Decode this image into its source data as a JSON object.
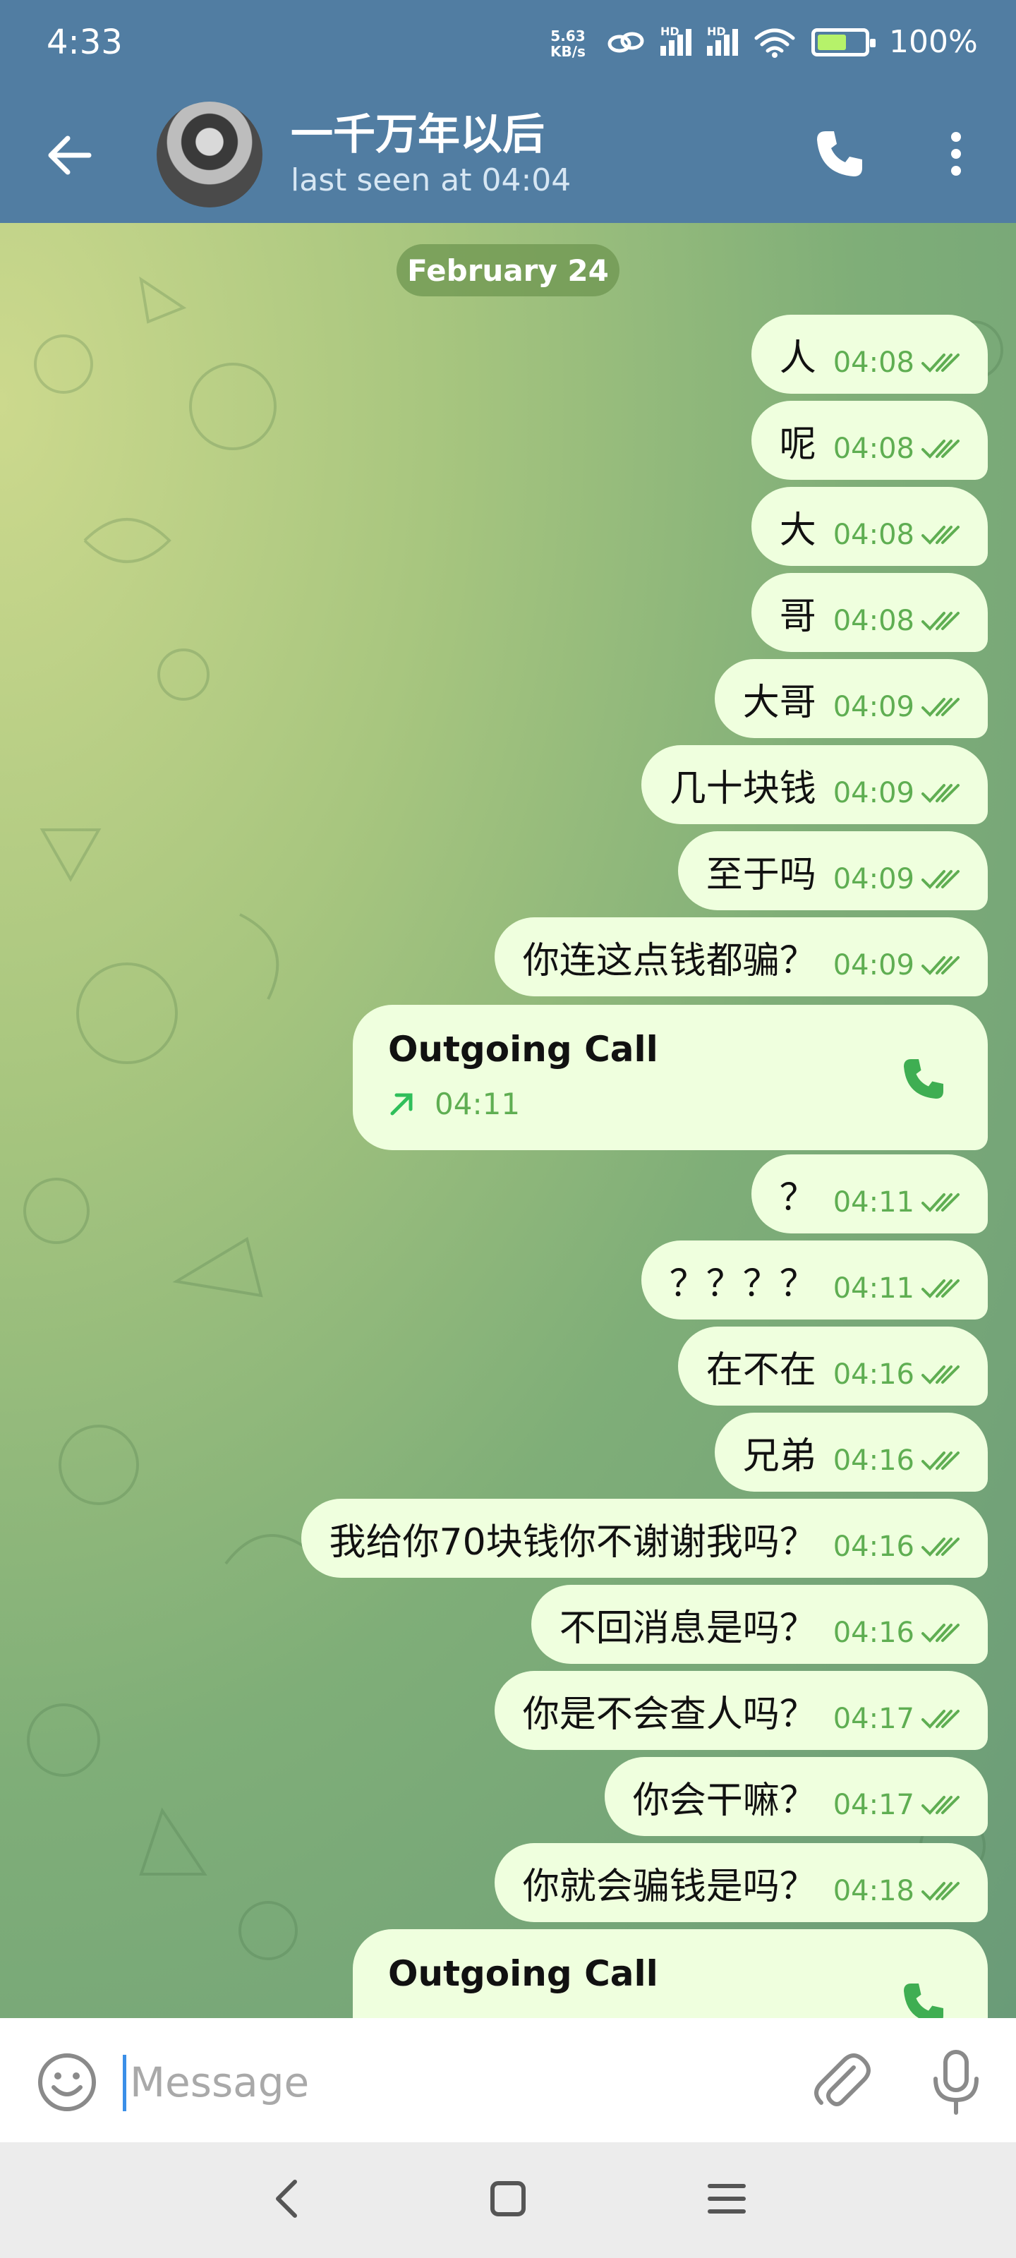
{
  "status": {
    "time": "4:33",
    "speed_value": "5.63",
    "speed_unit": "KB/s",
    "signal_label_1": "HD",
    "signal_label_2": "HD",
    "battery": "100%"
  },
  "header": {
    "title": "一千万年以后",
    "subtitle": "last seen at 04:04"
  },
  "date_divider": "February 24",
  "messages": [
    {
      "text": "人",
      "time": "04:08"
    },
    {
      "text": "呢",
      "time": "04:08"
    },
    {
      "text": "大",
      "time": "04:08"
    },
    {
      "text": "哥",
      "time": "04:08"
    },
    {
      "text": "大哥",
      "time": "04:09"
    },
    {
      "text": "几十块钱",
      "time": "04:09"
    },
    {
      "text": "至于吗",
      "time": "04:09"
    },
    {
      "text": "你连这点钱都骗？",
      "time": "04:09"
    },
    {
      "text": "？",
      "time": "04:11"
    },
    {
      "text": "？？？？",
      "time": "04:11"
    },
    {
      "text": "在不在",
      "time": "04:16"
    },
    {
      "text": "兄弟",
      "time": "04:16"
    },
    {
      "text": "我给你70块钱你不谢谢我吗？",
      "time": "04:16"
    },
    {
      "text": "不回消息是吗？",
      "time": "04:16"
    },
    {
      "text": "你是不会查人吗？",
      "time": "04:17"
    },
    {
      "text": "你会干嘛？",
      "time": "04:17"
    },
    {
      "text": "你就会骗钱是吗？",
      "time": "04:18"
    }
  ],
  "calls": [
    {
      "title": "Outgoing Call",
      "time": "04:11"
    },
    {
      "title": "Outgoing Call",
      "time": ""
    }
  ],
  "input": {
    "placeholder": "Message"
  },
  "colors": {
    "header": "#517da2",
    "bubble": "#efffde",
    "accent_green": "#5fae52"
  }
}
